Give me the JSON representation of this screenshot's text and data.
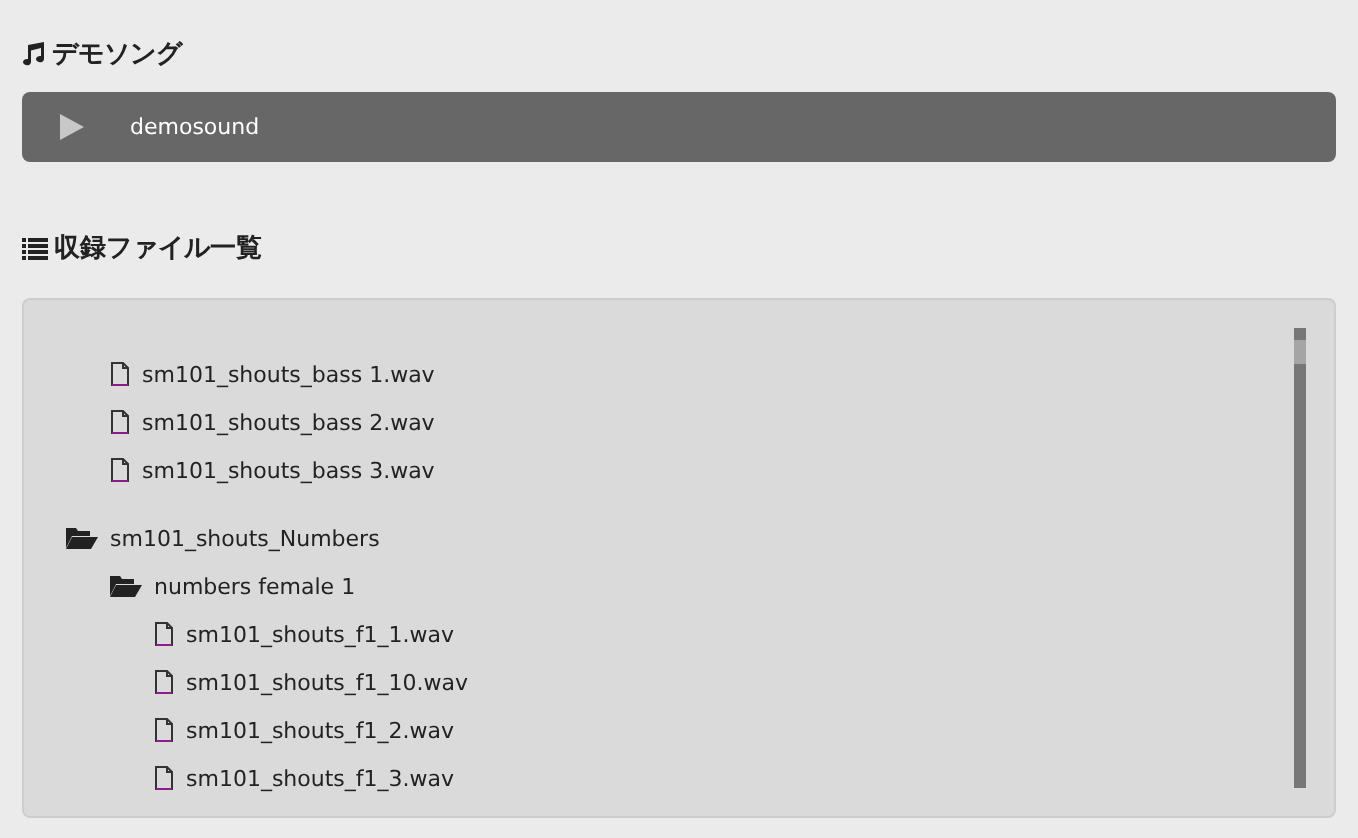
{
  "demo": {
    "title": "デモソング",
    "track": "demosound",
    "playing": false
  },
  "files": {
    "title": "収録ファイル一覧",
    "tree": [
      {
        "kind": "folder",
        "children": [
          {
            "kind": "file",
            "label": "sm101_shouts_bass 1.wav"
          },
          {
            "kind": "file",
            "label": "sm101_shouts_bass 2.wav"
          },
          {
            "kind": "file",
            "label": "sm101_shouts_bass 3.wav"
          }
        ]
      },
      {
        "kind": "folder",
        "label": "sm101_shouts_Numbers",
        "expanded": true,
        "children": [
          {
            "kind": "folder",
            "label": "numbers female 1",
            "expanded": true,
            "children": [
              {
                "kind": "file",
                "label": "sm101_shouts_f1_1.wav"
              },
              {
                "kind": "file",
                "label": "sm101_shouts_f1_10.wav"
              },
              {
                "kind": "file",
                "label": "sm101_shouts_f1_2.wav"
              },
              {
                "kind": "file",
                "label": "sm101_shouts_f1_3.wav"
              }
            ]
          }
        ]
      }
    ]
  }
}
